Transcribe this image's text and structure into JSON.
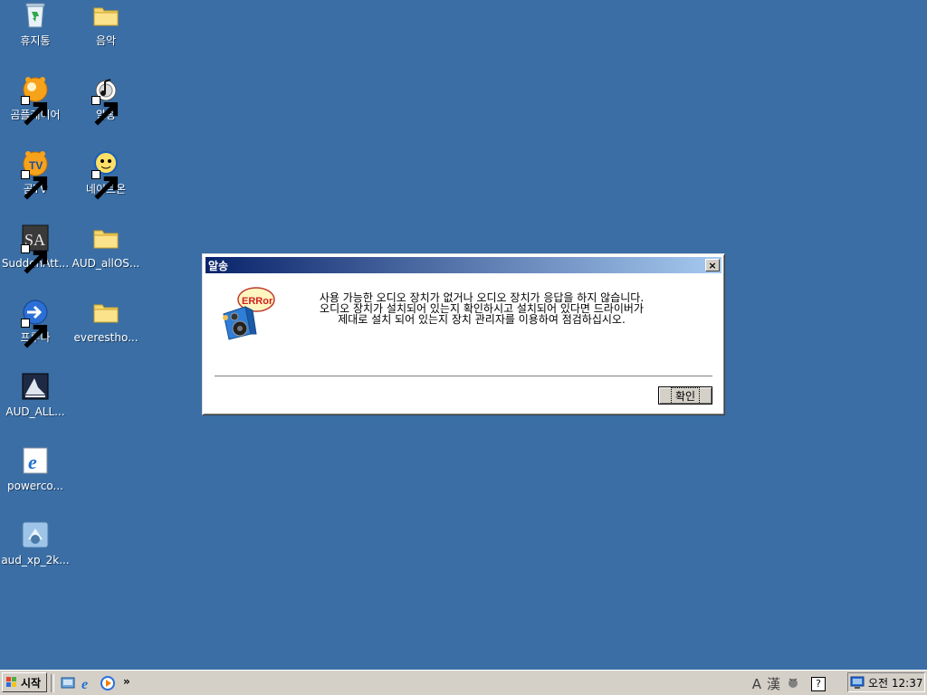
{
  "desktop": {
    "icons": [
      {
        "label": "휴지통",
        "icon": "recycle-bin-icon"
      },
      {
        "label": "음악",
        "icon": "folder-icon"
      },
      {
        "label": "곰플레이어",
        "icon": "gom-player-icon"
      },
      {
        "label": "알송",
        "icon": "alsong-icon"
      },
      {
        "label": "곰TV",
        "icon": "gom-tv-icon"
      },
      {
        "label": "네이트온",
        "icon": "nateon-icon"
      },
      {
        "label": "SuddenAtt...",
        "icon": "sudden-attack-icon"
      },
      {
        "label": "AUD_allOS...",
        "icon": "folder-icon"
      },
      {
        "label": "프루나",
        "icon": "pruna-icon"
      },
      {
        "label": "everestho...",
        "icon": "folder-icon"
      },
      {
        "label": "AUD_ALL...",
        "icon": "installer-icon"
      },
      {
        "label": "powerco...",
        "icon": "internet-explorer-icon"
      },
      {
        "label": "aud_xp_2k...",
        "icon": "setup-icon"
      }
    ]
  },
  "dialog": {
    "title": "알송",
    "close_label": "×",
    "icon": "error-speaker-icon",
    "icon_text": "ERRor",
    "message_lines": [
      "사용 가능한 오디오 장치가 없거나 오디오 장치가 응답을 하지 않습니다.",
      "오디오 장치가 설치되어 있는지 확인하시고 설치되어 있다면 드라이버가",
      "제대로 설치 되어 있는지 장치 관리자를 이용하여 점검하십시오."
    ],
    "ok_label": "확인"
  },
  "taskbar": {
    "start_label": "시작",
    "quicklaunch": [
      {
        "icon": "show-desktop-icon"
      },
      {
        "icon": "internet-explorer-icon"
      },
      {
        "icon": "media-player-icon"
      }
    ],
    "more_label": "»",
    "ime": {
      "mode": "A",
      "hanja": "漢",
      "help": "?"
    },
    "clock": "오전 12:37"
  },
  "colors": {
    "desktop_bg": "#3a6ea5",
    "titlebar_start": "#0a246a",
    "titlebar_end": "#a6caf0",
    "face": "#d4d0c8"
  }
}
